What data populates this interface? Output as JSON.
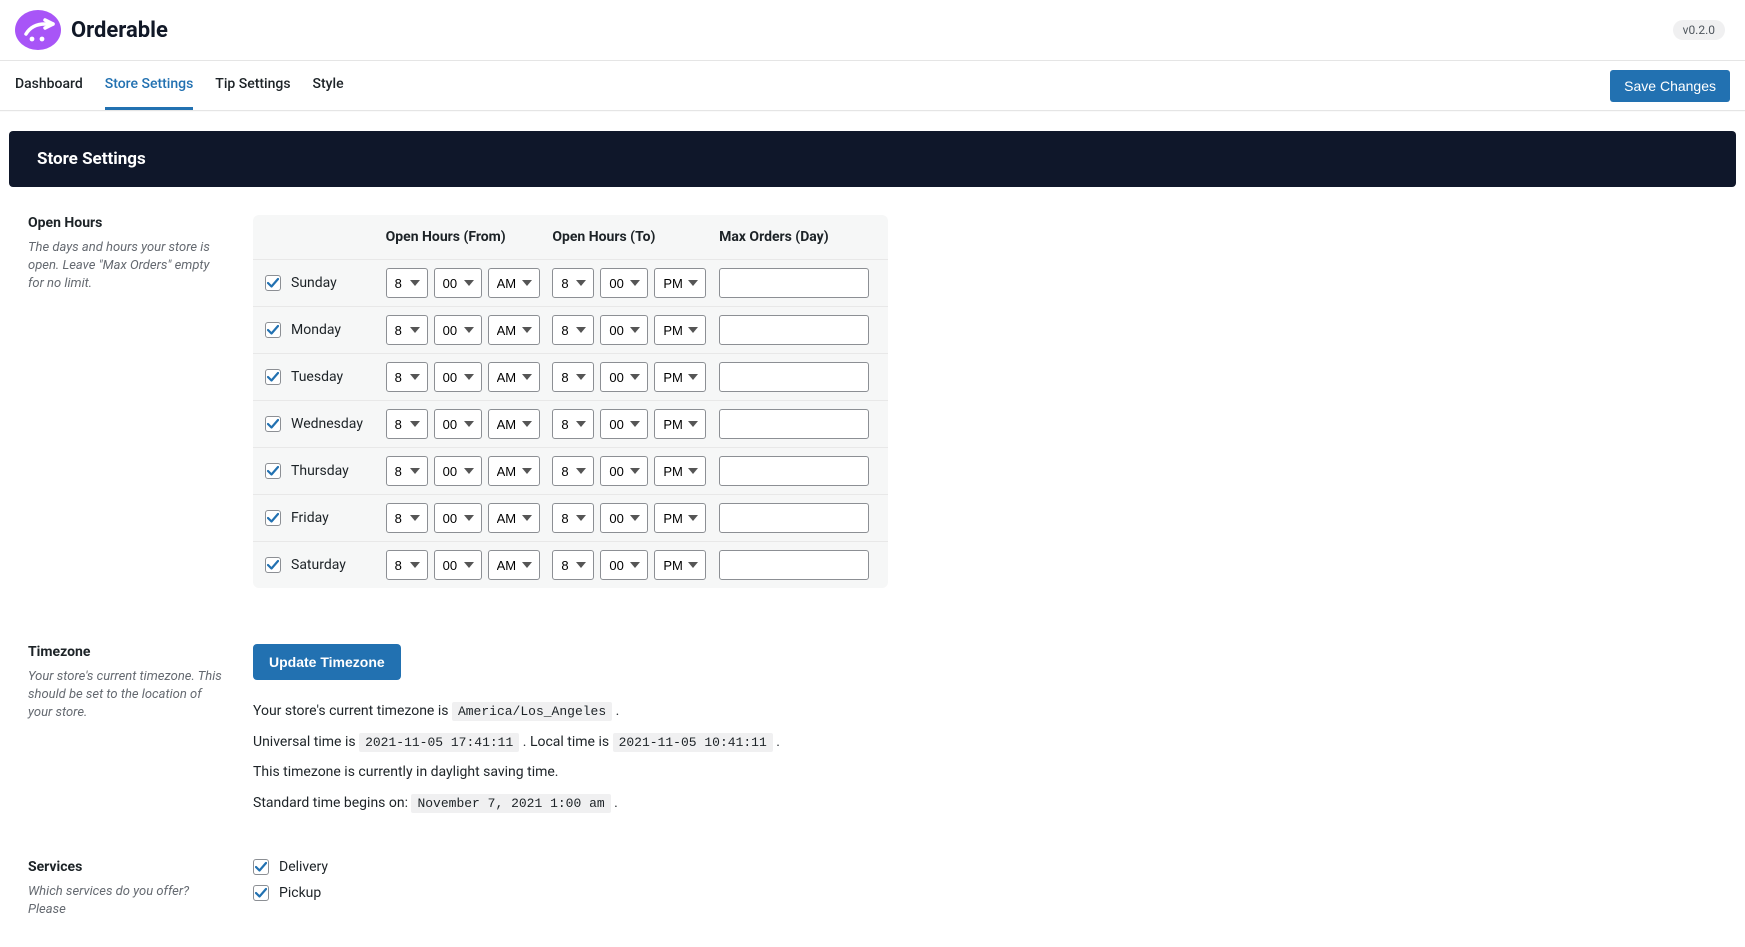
{
  "brand": "Orderable",
  "version": "v0.2.0",
  "tabs": [
    "Dashboard",
    "Store Settings",
    "Tip Settings",
    "Style"
  ],
  "active_tab": "Store Settings",
  "save_label": "Save Changes",
  "page_title": "Store Settings",
  "open_hours": {
    "title": "Open Hours",
    "help": "The days and hours your store is open. Leave \"Max Orders\" empty for no limit.",
    "columns": {
      "from": "Open Hours (From)",
      "to": "Open Hours (To)",
      "max": "Max Orders (Day)"
    },
    "days": [
      {
        "name": "Sunday",
        "checked": true,
        "from_hour": "8",
        "from_min": "00",
        "from_ampm": "AM",
        "to_hour": "8",
        "to_min": "00",
        "to_ampm": "PM",
        "max": ""
      },
      {
        "name": "Monday",
        "checked": true,
        "from_hour": "8",
        "from_min": "00",
        "from_ampm": "AM",
        "to_hour": "8",
        "to_min": "00",
        "to_ampm": "PM",
        "max": ""
      },
      {
        "name": "Tuesday",
        "checked": true,
        "from_hour": "8",
        "from_min": "00",
        "from_ampm": "AM",
        "to_hour": "8",
        "to_min": "00",
        "to_ampm": "PM",
        "max": ""
      },
      {
        "name": "Wednesday",
        "checked": true,
        "from_hour": "8",
        "from_min": "00",
        "from_ampm": "AM",
        "to_hour": "8",
        "to_min": "00",
        "to_ampm": "PM",
        "max": ""
      },
      {
        "name": "Thursday",
        "checked": true,
        "from_hour": "8",
        "from_min": "00",
        "from_ampm": "AM",
        "to_hour": "8",
        "to_min": "00",
        "to_ampm": "PM",
        "max": ""
      },
      {
        "name": "Friday",
        "checked": true,
        "from_hour": "8",
        "from_min": "00",
        "from_ampm": "AM",
        "to_hour": "8",
        "to_min": "00",
        "to_ampm": "PM",
        "max": ""
      },
      {
        "name": "Saturday",
        "checked": true,
        "from_hour": "8",
        "from_min": "00",
        "from_ampm": "AM",
        "to_hour": "8",
        "to_min": "00",
        "to_ampm": "PM",
        "max": ""
      }
    ]
  },
  "timezone": {
    "title": "Timezone",
    "help": "Your store's current timezone. This should be set to the location of your store.",
    "button": "Update Timezone",
    "line1_prefix": "Your store's current timezone is ",
    "timezone_value": "America/Los_Angeles",
    "line2_prefix": "Universal time is ",
    "utc_time": "2021-11-05 17:41:11",
    "line2_mid": ". Local time is ",
    "local_time": "2021-11-05 10:41:11",
    "line3": "This timezone is currently in daylight saving time.",
    "line4_prefix": "Standard time begins on: ",
    "std_time": "November 7, 2021 1:00 am",
    "period": "."
  },
  "services": {
    "title": "Services",
    "help": "Which services do you offer? Please",
    "options": [
      {
        "label": "Delivery",
        "checked": true
      },
      {
        "label": "Pickup",
        "checked": true
      }
    ]
  }
}
